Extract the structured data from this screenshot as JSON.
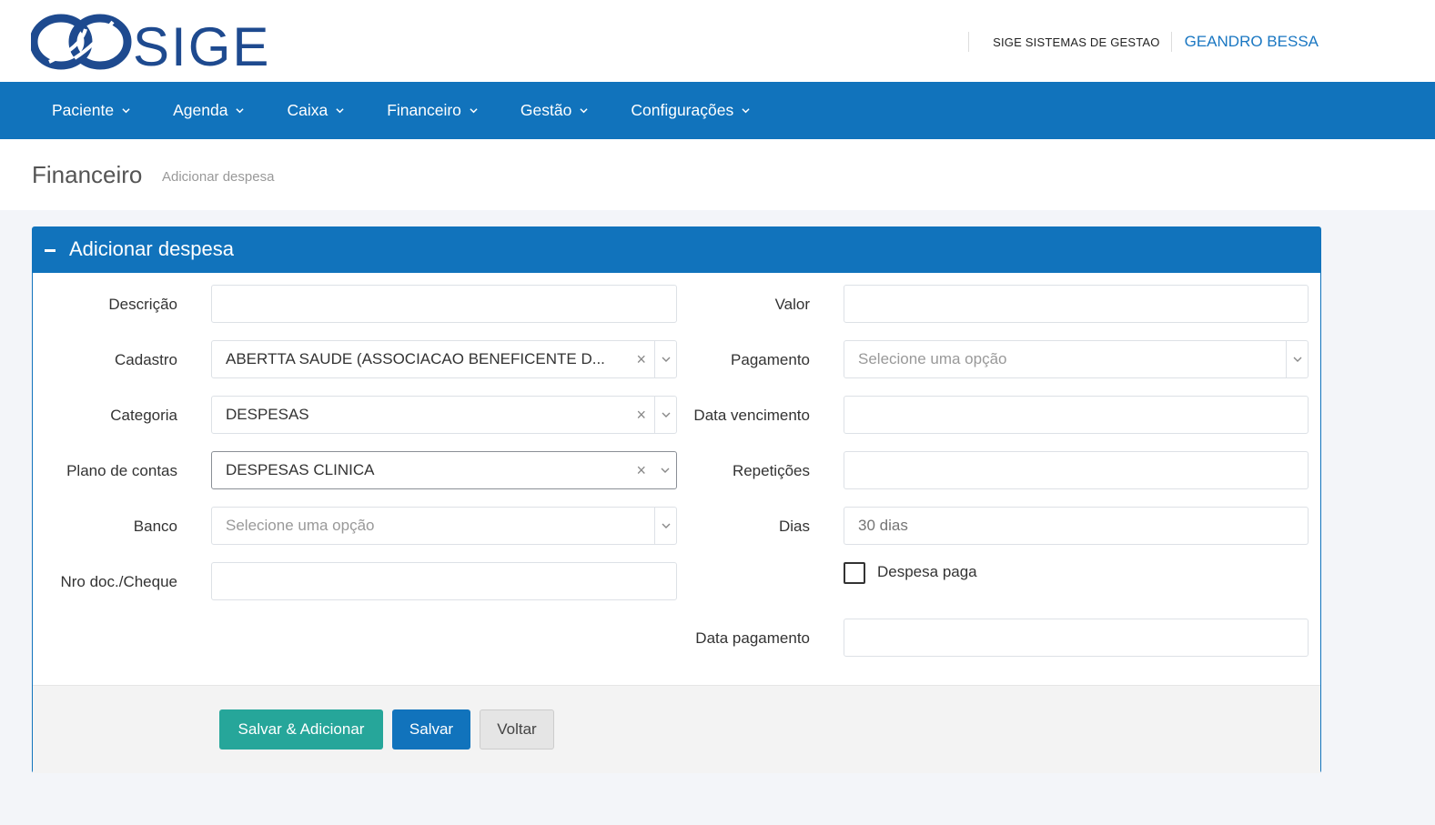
{
  "header": {
    "logo_text": "SIGE",
    "company": "SIGE SISTEMAS DE GESTAO",
    "user": "GEANDRO BESSA"
  },
  "nav": {
    "items": [
      {
        "label": "Paciente"
      },
      {
        "label": "Agenda"
      },
      {
        "label": "Caixa"
      },
      {
        "label": "Financeiro"
      },
      {
        "label": "Gestão"
      },
      {
        "label": "Configurações"
      }
    ]
  },
  "page": {
    "title": "Financeiro",
    "subtitle": "Adicionar despesa"
  },
  "panel": {
    "title": "Adicionar despesa"
  },
  "form": {
    "descricao": {
      "label": "Descrição",
      "value": ""
    },
    "cadastro": {
      "label": "Cadastro",
      "value": "ABERTTA SAUDE (ASSOCIACAO BENEFICENTE D..."
    },
    "categoria": {
      "label": "Categoria",
      "value": "DESPESAS"
    },
    "plano_contas": {
      "label": "Plano de contas",
      "value": "DESPESAS CLINICA"
    },
    "banco": {
      "label": "Banco",
      "placeholder": "Selecione uma opção"
    },
    "nro_doc": {
      "label": "Nro doc./Cheque",
      "value": ""
    },
    "valor": {
      "label": "Valor",
      "value": ""
    },
    "pagamento": {
      "label": "Pagamento",
      "placeholder": "Selecione uma opção"
    },
    "data_vencimento": {
      "label": "Data vencimento",
      "value": ""
    },
    "repeticoes": {
      "label": "Repetições",
      "value": ""
    },
    "dias": {
      "label": "Dias",
      "placeholder": "30 dias"
    },
    "despesa_paga": {
      "label": "Despesa paga",
      "checked": false
    },
    "data_pagamento": {
      "label": "Data pagamento",
      "value": ""
    },
    "clear_symbol": "×"
  },
  "buttons": {
    "save_add": "Salvar & Adicionar",
    "save": "Salvar",
    "back": "Voltar"
  },
  "colors": {
    "primary": "#1173bc",
    "success": "#26a69a",
    "background": "#f3f5f9"
  }
}
